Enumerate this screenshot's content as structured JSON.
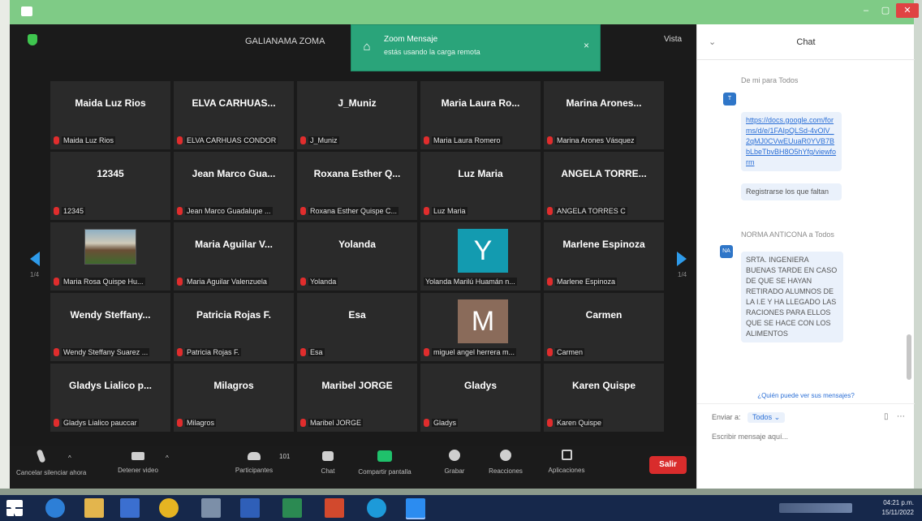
{
  "window": {
    "min_glyph": "–",
    "max_glyph": "▢",
    "close_glyph": "✕"
  },
  "meeting": {
    "label": "GALIANAMA ZOMA",
    "view_label": "Vista"
  },
  "notification": {
    "title": "Zoom Mensaje",
    "subtitle": "estás usando la carga remota",
    "close": "×"
  },
  "gallery": {
    "page_left": "1/4",
    "page_right": "1/4",
    "tiles": [
      {
        "name": "Maida Luz Rios",
        "sub": "Maida Luz Rios"
      },
      {
        "name": "ELVA CARHUAS...",
        "sub": "ELVA CARHUAS CONDOR"
      },
      {
        "name": "J_Muniz",
        "sub": "J_Muniz"
      },
      {
        "name": "Maria Laura Ro...",
        "sub": "Maria Laura Romero"
      },
      {
        "name": "Marina Arones...",
        "sub": "Marina Arones Vásquez"
      },
      {
        "name": "12345",
        "sub": "12345"
      },
      {
        "name": "Jean Marco Gua...",
        "sub": "Jean Marco Guadalupe ..."
      },
      {
        "name": "Roxana Esther Q...",
        "sub": "Roxana Esther Quispe C..."
      },
      {
        "name": "Luz Maria",
        "sub": "Luz Maria"
      },
      {
        "name": "ANGELA TORRE...",
        "sub": "ANGELA TORRES C"
      },
      {
        "name": "",
        "sub": "Maria Rosa Quispe Hu..."
      },
      {
        "name": "Maria Aguilar V...",
        "sub": "Maria Aguilar Valenzuela"
      },
      {
        "name": "Yolanda",
        "sub": "Yolanda"
      },
      {
        "name": "",
        "sub": "Yolanda Marilú Huamán n...",
        "avatar": "Y"
      },
      {
        "name": "Marlene Espinoza",
        "sub": "Marlene Espinoza"
      },
      {
        "name": "Wendy Steffany...",
        "sub": "Wendy Steffany Suarez ..."
      },
      {
        "name": "Patricia Rojas F.",
        "sub": "Patricia Rojas F."
      },
      {
        "name": "Esa",
        "sub": "Esa"
      },
      {
        "name": "",
        "sub": "miguel angel herrera m...",
        "avatar": "M"
      },
      {
        "name": "Carmen",
        "sub": "Carmen"
      },
      {
        "name": "Gladys Lialico p...",
        "sub": "Gladys Lialico pauccar"
      },
      {
        "name": "Milagros",
        "sub": "Milagros"
      },
      {
        "name": "Maribel JORGE",
        "sub": "Maribel JORGE"
      },
      {
        "name": "Gladys",
        "sub": "Gladys"
      },
      {
        "name": "Karen Quispe",
        "sub": "Karen Quispe"
      }
    ]
  },
  "toolbar": {
    "unmute": "Cancelar silenciar ahora",
    "video": "Detener video",
    "participants": "Participantes",
    "participants_count": "101",
    "chat": "Chat",
    "share": "Compartir pantalla",
    "record": "Grabar",
    "reactions": "Reacciones",
    "apps": "Aplicaciones",
    "leave": "Salir"
  },
  "chat": {
    "title": "Chat",
    "collapse": "⌄",
    "msg1_meta": "De mi para Todos",
    "msg1_avatar": "T",
    "msg1_link": "https://docs.google.com/forms/d/e/1FAIpQLSd-4vOlV_2qMJ0CVwEUuaR0YVB7BbLbeTbvBH8O5hYfg/viewform",
    "msg1_text": "Registrarse los que faltan",
    "msg2_meta": "NORMA ANTICONA a Todos",
    "msg2_avatar": "NA",
    "msg2_text": "SRTA. INGENIERA BUENAS TARDE EN CASO DE QUE SE HAYAN RETIRADO ALUMNOS DE LA I.E Y HA LLEGADO LAS RACIONES PARA ELLOS QUE SE HACE CON LOS ALIMENTOS",
    "who_can_see": "¿Quién puede ver sus mensajes?",
    "send_to": "Enviar a:",
    "send_target": "Todos ⌄",
    "input_placeholder": "Escribir mensaje aquí..."
  },
  "taskbar": {
    "time": "04:21 p.m.",
    "date": "15/11/2022"
  },
  "colors": {
    "accent_green": "#2aa47a",
    "leave_red": "#d92c2c",
    "link_blue": "#2b6fd6",
    "arrow_blue": "#2e9bea",
    "avatar_y": "#139bb0",
    "avatar_m": "#8a6b5a"
  }
}
